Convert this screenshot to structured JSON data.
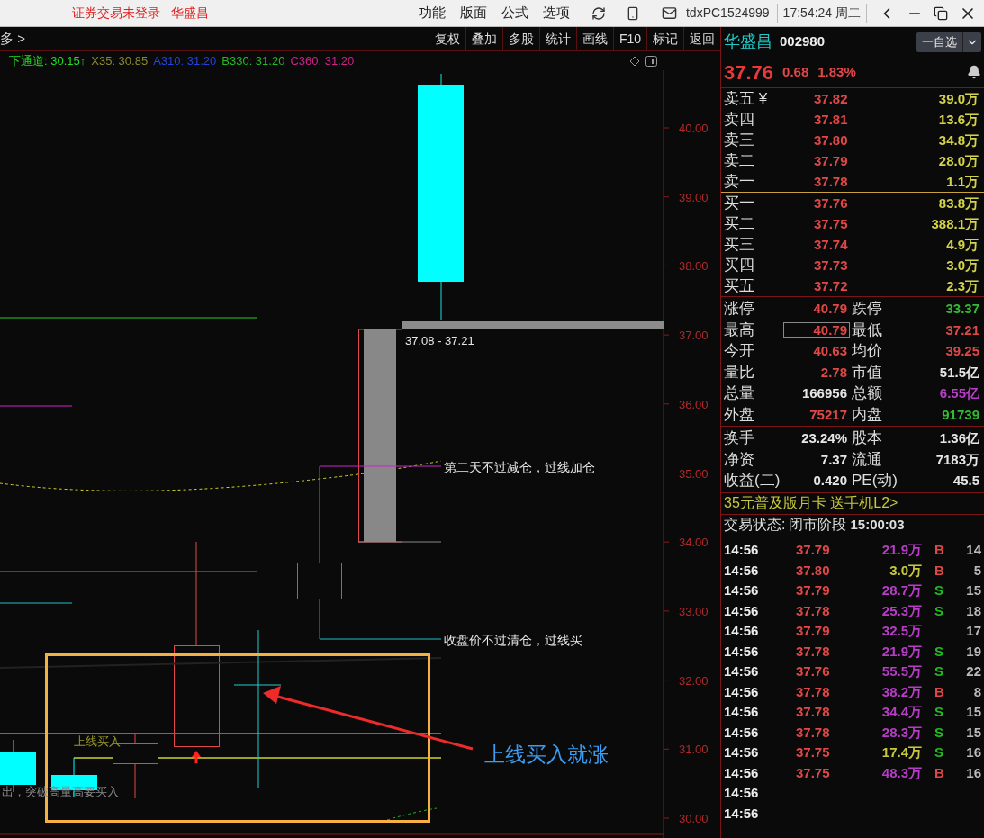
{
  "title_bar": {
    "status": "证券交易未登录",
    "stock": "华盛昌",
    "menu": [
      "功能",
      "版面",
      "公式",
      "选项"
    ],
    "account": "tdxPC1524999",
    "clock": "17:54:24 周二"
  },
  "toolbar": {
    "breadcrumb": "多 >",
    "buttons": [
      "复权",
      "叠加",
      "多股",
      "统计",
      "画线",
      "F10",
      "标记",
      "返回"
    ]
  },
  "indicators": [
    {
      "text": "下通道: 30.15↑",
      "color": "#22dd22"
    },
    {
      "text": "X35: 30.85",
      "color": "#8a8a2a"
    },
    {
      "text": "A310: 31.20",
      "color": "#2244dd"
    },
    {
      "text": "B330: 31.20",
      "color": "#22bb22"
    },
    {
      "text": "C360: 31.20",
      "color": "#cc2288"
    }
  ],
  "chart": {
    "price_labels": [
      "40.00",
      "39.00",
      "38.00",
      "37.00",
      "36.00",
      "35.00",
      "34.00",
      "33.00",
      "32.00",
      "31.00",
      "30.00"
    ],
    "range_label": "37.08 - 37.21",
    "notes": [
      "第二天不过减仓，过线加仓",
      "收盘价不过清仓，过线买"
    ],
    "line_label": "上线买入",
    "footnote": "出，突破高量高要买入",
    "callout": "上线买入就涨"
  },
  "quote": {
    "name": "华盛昌",
    "code": "002980",
    "watch_button": "一自选",
    "price": "37.76",
    "change": "0.68",
    "percent": "1.83%"
  },
  "order_book": {
    "asks": [
      {
        "label": "卖五 ¥",
        "price": "37.82",
        "volume": "39.0万"
      },
      {
        "label": "卖四",
        "price": "37.81",
        "volume": "13.6万"
      },
      {
        "label": "卖三",
        "price": "37.80",
        "volume": "34.8万"
      },
      {
        "label": "卖二",
        "price": "37.79",
        "volume": "28.0万"
      },
      {
        "label": "卖一",
        "price": "37.78",
        "volume": "1.1万"
      }
    ],
    "bids": [
      {
        "label": "买一",
        "price": "37.76",
        "volume": "83.8万"
      },
      {
        "label": "买二",
        "price": "37.75",
        "volume": "388.1万"
      },
      {
        "label": "买三",
        "price": "37.74",
        "volume": "4.9万"
      },
      {
        "label": "买四",
        "price": "37.73",
        "volume": "3.0万"
      },
      {
        "label": "买五",
        "price": "37.72",
        "volume": "2.3万"
      }
    ]
  },
  "stats": [
    {
      "left": {
        "label": "涨停",
        "value": "40.79",
        "color": "#e04848",
        "boxed": false
      },
      "right": {
        "label": "跌停",
        "value": "33.37",
        "color": "#33bb33"
      }
    },
    {
      "left": {
        "label": "最高",
        "value": "40.79",
        "color": "#e04848",
        "boxed": true
      },
      "right": {
        "label": "最低",
        "value": "37.21",
        "color": "#e04848"
      }
    },
    {
      "left": {
        "label": "今开",
        "value": "40.63",
        "color": "#e04848",
        "boxed": false
      },
      "right": {
        "label": "均价",
        "value": "39.25",
        "color": "#e04848"
      }
    },
    {
      "left": {
        "label": "量比",
        "value": "2.78",
        "color": "#e04848",
        "boxed": false
      },
      "right": {
        "label": "市值",
        "value": "51.5亿",
        "color": "#e6e6e6"
      }
    },
    {
      "left": {
        "label": "总量",
        "value": "166956",
        "color": "#e6e6e6",
        "boxed": false
      },
      "right": {
        "label": "总额",
        "value": "6.55亿",
        "color": "#b83cc8"
      }
    },
    {
      "left": {
        "label": "外盘",
        "value": "75217",
        "color": "#e04848",
        "boxed": false
      },
      "right": {
        "label": "内盘",
        "value": "91739",
        "color": "#33bb33"
      }
    }
  ],
  "fundamentals": [
    {
      "label": "换手",
      "value": "23.24%",
      "label2": "股本",
      "value2": "1.36亿"
    },
    {
      "label": "净资",
      "value": "7.37",
      "label2": "流通",
      "value2": "7183万"
    },
    {
      "label": "收益(二)",
      "value": "0.420",
      "label2": "PE(动)",
      "value2": "45.5"
    }
  ],
  "promo": "35元普及版月卡 送手机L2>",
  "trade_status": {
    "label": "交易状态:",
    "phase": "闭市阶段",
    "time": "15:00:03"
  },
  "ticks": [
    {
      "time": "14:56",
      "price": "37.79",
      "volume": "21.9万",
      "color": "#b83cc8",
      "side": "B",
      "kind": "buy",
      "count": "14"
    },
    {
      "time": "14:56",
      "price": "37.80",
      "volume": "3.0万",
      "color": "#c8c83c",
      "side": "B",
      "kind": "buy",
      "count": "5"
    },
    {
      "time": "14:56",
      "price": "37.79",
      "volume": "28.7万",
      "color": "#b83cc8",
      "side": "S",
      "kind": "sell",
      "count": "15"
    },
    {
      "time": "14:56",
      "price": "37.78",
      "volume": "25.3万",
      "color": "#b83cc8",
      "side": "S",
      "kind": "sell",
      "count": "18"
    },
    {
      "time": "14:56",
      "price": "37.79",
      "volume": "32.5万",
      "color": "#b83cc8",
      "count": "17"
    },
    {
      "time": "14:56",
      "price": "37.78",
      "volume": "21.9万",
      "color": "#b83cc8",
      "side": "S",
      "kind": "sell",
      "count": "19"
    },
    {
      "time": "14:56",
      "price": "37.76",
      "volume": "55.5万",
      "color": "#b83cc8",
      "side": "S",
      "kind": "sell",
      "count": "22"
    },
    {
      "time": "14:56",
      "price": "37.78",
      "volume": "38.2万",
      "color": "#b83cc8",
      "side": "B",
      "kind": "buy",
      "count": "8"
    },
    {
      "time": "14:56",
      "price": "37.78",
      "volume": "34.4万",
      "color": "#b83cc8",
      "side": "S",
      "kind": "sell",
      "count": "15"
    },
    {
      "time": "14:56",
      "price": "37.78",
      "volume": "28.3万",
      "color": "#b83cc8",
      "side": "S",
      "kind": "sell",
      "count": "15"
    },
    {
      "time": "14:56",
      "price": "37.75",
      "volume": "17.4万",
      "color": "#c8c83c",
      "side": "S",
      "kind": "sell",
      "count": "16"
    },
    {
      "time": "14:56",
      "price": "37.75",
      "volume": "48.3万",
      "color": "#b83cc8",
      "side": "B",
      "kind": "buy",
      "count": "16"
    },
    {
      "time": "14:56"
    },
    {
      "time": "14:56"
    }
  ]
}
